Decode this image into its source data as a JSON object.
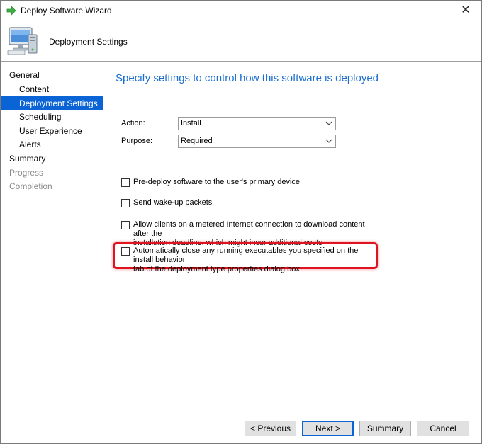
{
  "window": {
    "title": "Deploy Software Wizard"
  },
  "header": {
    "title": "Deployment Settings"
  },
  "nav": {
    "items": [
      {
        "label": "General",
        "level": 0,
        "state": "normal"
      },
      {
        "label": "Content",
        "level": 1,
        "state": "normal"
      },
      {
        "label": "Deployment Settings",
        "level": 1,
        "state": "active"
      },
      {
        "label": "Scheduling",
        "level": 1,
        "state": "normal"
      },
      {
        "label": "User Experience",
        "level": 1,
        "state": "normal"
      },
      {
        "label": "Alerts",
        "level": 1,
        "state": "normal"
      },
      {
        "label": "Summary",
        "level": 0,
        "state": "normal"
      },
      {
        "label": "Progress",
        "level": 0,
        "state": "disabled"
      },
      {
        "label": "Completion",
        "level": 0,
        "state": "disabled"
      }
    ]
  },
  "main": {
    "heading": "Specify settings to control how this software is deployed",
    "action": {
      "label": "Action:",
      "value": "Install"
    },
    "purpose": {
      "label": "Purpose:",
      "value": "Required"
    },
    "checkboxes": [
      {
        "line1": "Pre-deploy software to the user's primary device",
        "line2": "",
        "checked": false
      },
      {
        "line1": "Send wake-up packets",
        "line2": "",
        "checked": false
      },
      {
        "line1": "Allow clients on a metered Internet connection to download content after the",
        "line2": "installation deadline, which might incur additional costs",
        "checked": false
      },
      {
        "line1": "Automatically close any running executables you specified on the install behavior",
        "line2": "tab of the deployment type properties dialog box",
        "checked": false
      }
    ]
  },
  "footer": {
    "previous": "< Previous",
    "next": "Next >",
    "summary": "Summary",
    "cancel": "Cancel"
  },
  "colors": {
    "accent": "#0a64d6",
    "heading": "#1a6ecf",
    "highlight": "#e0141e"
  }
}
